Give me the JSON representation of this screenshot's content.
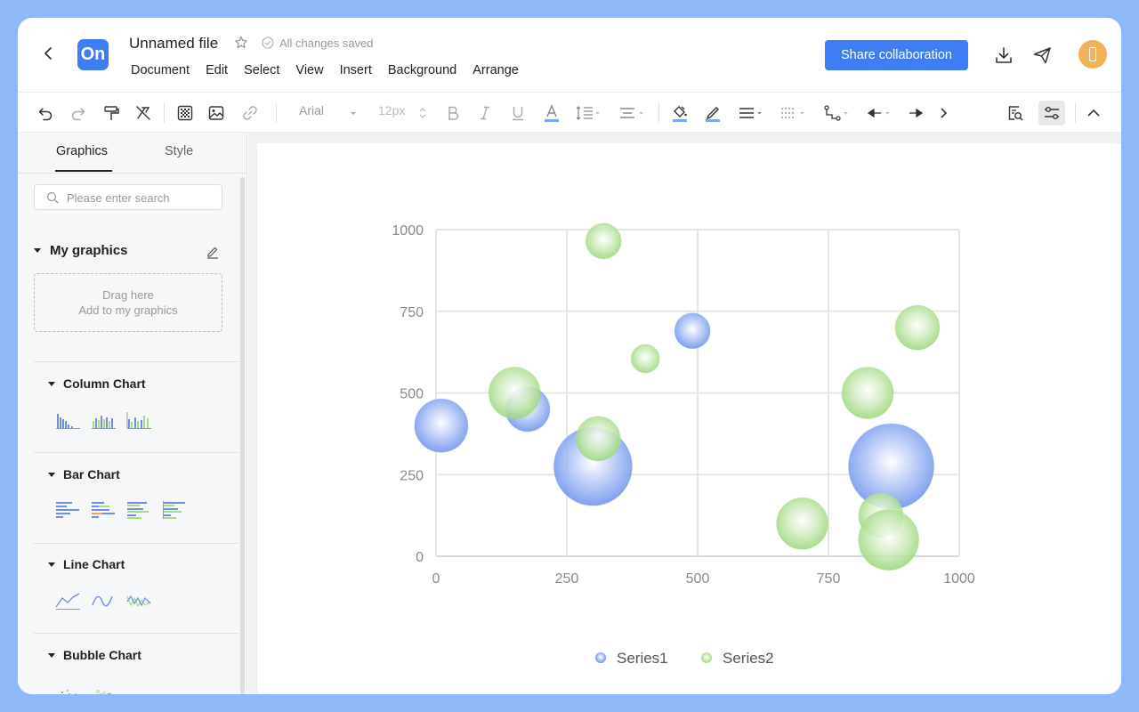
{
  "header": {
    "title": "Unnamed file",
    "saved_status": "All changes saved",
    "logo_text": "On",
    "menu": [
      "Document",
      "Edit",
      "Select",
      "View",
      "Insert",
      "Background",
      "Arrange"
    ],
    "share_label": "Share collaboration"
  },
  "toolbar": {
    "font_family": "Arial",
    "font_size": "12px"
  },
  "sidebar": {
    "tabs": [
      "Graphics",
      "Style"
    ],
    "search_placeholder": "Please enter search",
    "my_graphics": "My graphics",
    "drop_line1": "Drag here",
    "drop_line2": "Add to my graphics",
    "groups": [
      "Column Chart",
      "Bar Chart",
      "Line Chart",
      "Bubble Chart"
    ]
  },
  "colors": {
    "accent": "#3d7ef5",
    "series1": "#7b9ef0",
    "series2": "#a6db86"
  },
  "chart_data": {
    "type": "scatter",
    "subtype": "bubble",
    "xlim": [
      0,
      1000
    ],
    "ylim": [
      0,
      1000
    ],
    "xticks": [
      "0",
      "250",
      "500",
      "750",
      "1000"
    ],
    "yticks": [
      "0",
      "250",
      "500",
      "750",
      "1000"
    ],
    "grid": true,
    "legend_position": "bottom",
    "series": [
      {
        "name": "Series1",
        "points": [
          {
            "x": 10,
            "y": 400,
            "size": 30
          },
          {
            "x": 175,
            "y": 450,
            "size": 25
          },
          {
            "x": 300,
            "y": 275,
            "size": 44
          },
          {
            "x": 490,
            "y": 690,
            "size": 20
          },
          {
            "x": 870,
            "y": 275,
            "size": 48
          }
        ]
      },
      {
        "name": "Series2",
        "points": [
          {
            "x": 150,
            "y": 500,
            "size": 29
          },
          {
            "x": 310,
            "y": 360,
            "size": 25
          },
          {
            "x": 320,
            "y": 965,
            "size": 20
          },
          {
            "x": 400,
            "y": 605,
            "size": 16
          },
          {
            "x": 700,
            "y": 100,
            "size": 29
          },
          {
            "x": 825,
            "y": 500,
            "size": 29
          },
          {
            "x": 850,
            "y": 125,
            "size": 25
          },
          {
            "x": 865,
            "y": 50,
            "size": 34
          },
          {
            "x": 920,
            "y": 700,
            "size": 25
          }
        ]
      }
    ]
  }
}
